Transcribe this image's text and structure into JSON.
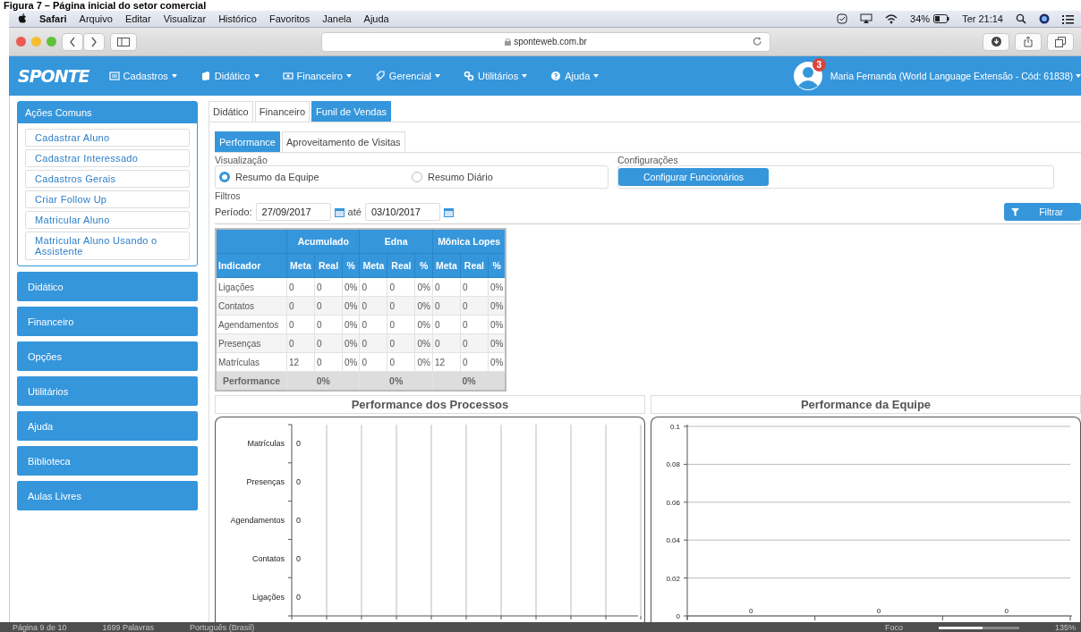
{
  "caption": "Figura 7 – Página inicial do setor comercial",
  "menubar": {
    "app": "Safari",
    "items": [
      "Arquivo",
      "Editar",
      "Visualizar",
      "Histórico",
      "Favoritos",
      "Janela",
      "Ajuda"
    ],
    "battery": "34%",
    "clock": "Ter 21:14"
  },
  "browser": {
    "url": "sponteweb.com.br"
  },
  "navbar": {
    "logo": "SPONTE",
    "menus": [
      "Cadastros",
      "Didático",
      "Financeiro",
      "Gerencial",
      "Utilitários",
      "Ajuda"
    ],
    "notifications": "3",
    "user": "Maria Fernanda (World Language Extensão - Cód: 61838)"
  },
  "sidebar": {
    "common_title": "Ações Comuns",
    "actions": [
      "Cadastrar Aluno",
      "Cadastrar Interessado",
      "Cadastros Gerais",
      "Criar Follow Up",
      "Matricular Aluno",
      "Matricular Aluno Usando o Assistente"
    ],
    "sections": [
      "Didático",
      "Financeiro",
      "Opções",
      "Utilitários",
      "Ajuda",
      "Biblioteca",
      "Aulas Livres"
    ]
  },
  "tabs": [
    {
      "label": "Didático",
      "selected": false
    },
    {
      "label": "Financeiro",
      "selected": false
    },
    {
      "label": "Funil de Vendas",
      "selected": true
    }
  ],
  "subtabs": [
    {
      "label": "Performance",
      "selected": true
    },
    {
      "label": "Aproveitamento de Visitas",
      "selected": false
    }
  ],
  "visualizacao": {
    "legend": "Visualização",
    "options": [
      {
        "label": "Resumo da Equipe",
        "selected": true
      },
      {
        "label": "Resumo Diário",
        "selected": false
      }
    ]
  },
  "configuracoes": {
    "legend": "Configurações",
    "button": "Configurar Funcionários"
  },
  "filtros": {
    "legend": "Filtros",
    "period_label": "Período:",
    "from": "27/09/2017",
    "separator": "até",
    "to": "03/10/2017",
    "button": "Filtrar"
  },
  "table": {
    "indicator_header": "Indicador",
    "groups": [
      {
        "name": "Acumulado",
        "subcolumns": [
          "Meta",
          "Real",
          "%"
        ]
      },
      {
        "name": "Edna",
        "subcolumns": [
          "Meta",
          "Real",
          "%"
        ]
      },
      {
        "name": "Mônica Lopes",
        "subcolumns": [
          "Meta",
          "Real",
          "%"
        ]
      }
    ],
    "rows": [
      {
        "name": "Ligações",
        "cells": [
          "0",
          "0",
          "0%",
          "0",
          "0",
          "0%",
          "0",
          "0",
          "0%"
        ]
      },
      {
        "name": "Contatos",
        "cells": [
          "0",
          "0",
          "0%",
          "0",
          "0",
          "0%",
          "0",
          "0",
          "0%"
        ]
      },
      {
        "name": "Agendamentos",
        "cells": [
          "0",
          "0",
          "0%",
          "0",
          "0",
          "0%",
          "0",
          "0",
          "0%"
        ]
      },
      {
        "name": "Presenças",
        "cells": [
          "0",
          "0",
          "0%",
          "0",
          "0",
          "0%",
          "0",
          "0",
          "0%"
        ]
      },
      {
        "name": "Matrículas",
        "cells": [
          "12",
          "0",
          "0%",
          "0",
          "0",
          "0%",
          "12",
          "0",
          "0%"
        ]
      }
    ],
    "footer": {
      "label": "Performance",
      "values": [
        "0%",
        "0%",
        "0%"
      ]
    }
  },
  "charts": [
    {
      "title": "Performance dos Processos",
      "rows": [
        {
          "label": "Matrículas",
          "value": "0"
        },
        {
          "label": "Presenças",
          "value": "0"
        },
        {
          "label": "Agendamentos",
          "value": "0"
        },
        {
          "label": "Contatos",
          "value": "0"
        },
        {
          "label": "Ligações",
          "value": "0"
        }
      ]
    },
    {
      "title": "Performance da Equipe",
      "chart_data": {
        "type": "bar",
        "orientation": "vertical",
        "categories": [
          null,
          null,
          null
        ],
        "values": [
          0,
          0,
          0
        ],
        "value_labels": [
          "0",
          "0",
          "0"
        ],
        "ylim": [
          0,
          0.1
        ],
        "yticks": [
          {
            "value": 0,
            "label": "0"
          },
          {
            "value": 0.02,
            "label": "0.02"
          },
          {
            "value": 0.04,
            "label": "0.04"
          },
          {
            "value": 0.06,
            "label": "0.06"
          },
          {
            "value": 0.08,
            "label": "0.08"
          },
          {
            "value": 0.1,
            "label": "0.1"
          }
        ],
        "grid": true
      }
    }
  ],
  "status_bar": {
    "page": "Página 9 de 10",
    "words": "1699 Palavras",
    "language": "Português (Brasil)",
    "focus": "Foco",
    "zoom": "135%",
    "zoom_slider": {
      "level": 0.55
    }
  }
}
